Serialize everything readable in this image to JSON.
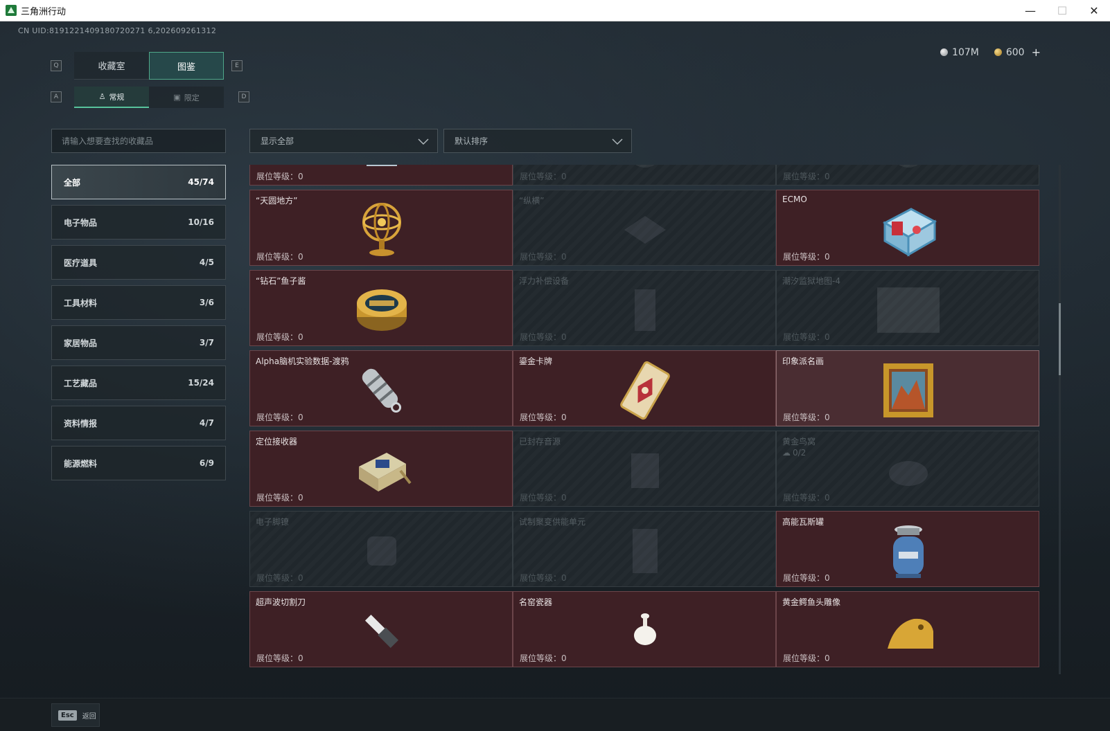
{
  "window": {
    "title": "三角洲行动",
    "minimize": "—",
    "maximize": "☐",
    "close": "✕"
  },
  "uid": "CN UID:8191221409180720271 6,202609261312",
  "currency": {
    "silver": "107M",
    "gold": "600",
    "plus": "+"
  },
  "keys": {
    "prev_tab": "Q",
    "next_tab": "E",
    "prev_sub": "A",
    "next_sub": "D"
  },
  "main_tabs": [
    {
      "label": "收藏室"
    },
    {
      "label": "图鉴"
    }
  ],
  "sub_tabs": [
    {
      "label": "常规"
    },
    {
      "label": "限定"
    }
  ],
  "search": {
    "placeholder": "请输入想要查找的收藏品"
  },
  "categories": [
    {
      "name": "全部",
      "count": "45/74"
    },
    {
      "name": "电子物品",
      "count": "10/16"
    },
    {
      "name": "医疗道具",
      "count": "4/5"
    },
    {
      "name": "工具材料",
      "count": "3/6"
    },
    {
      "name": "家居物品",
      "count": "3/7"
    },
    {
      "name": "工艺藏品",
      "count": "15/24"
    },
    {
      "name": "资料情报",
      "count": "4/7"
    },
    {
      "name": "能源燃料",
      "count": "6/9"
    }
  ],
  "filters": {
    "display": "显示全部",
    "sort": "默认排序"
  },
  "cards": [
    {
      "name": "",
      "level": "展位等级：0",
      "state": "owned",
      "icon": "robot-arm-icon"
    },
    {
      "name": "",
      "level": "展位等级：0",
      "state": "locked",
      "icon": "unknown-icon"
    },
    {
      "name": "",
      "level": "展位等级：0",
      "state": "locked",
      "icon": "unknown-icon"
    },
    {
      "name": "“天圆地方”",
      "level": "展位等级：0",
      "state": "owned",
      "icon": "armillary-sphere-icon"
    },
    {
      "name": "“纵横”",
      "level": "展位等级：0",
      "state": "locked",
      "icon": "chessboard-icon"
    },
    {
      "name": "ECMO",
      "level": "展位等级：0",
      "state": "owned",
      "icon": "ecmo-machine-icon"
    },
    {
      "name": "“钻石”鱼子酱",
      "level": "展位等级：0",
      "state": "owned",
      "icon": "caviar-tin-icon"
    },
    {
      "name": "浮力补偿设备",
      "level": "展位等级：0",
      "state": "locked",
      "icon": "buoyancy-device-icon"
    },
    {
      "name": "潮汐监狱地图-4",
      "level": "展位等级：0",
      "state": "locked",
      "icon": "map-icon"
    },
    {
      "name": "Alpha脑机实验数据-渡鸦",
      "level": "展位等级：0",
      "state": "owned",
      "icon": "data-capsule-icon"
    },
    {
      "name": "鎏金卡牌",
      "level": "展位等级：0",
      "state": "owned",
      "icon": "gilded-card-icon"
    },
    {
      "name": "印象派名画",
      "level": "展位等级：0",
      "state": "owned-light",
      "icon": "painting-icon"
    },
    {
      "name": "定位接收器",
      "level": "展位等级：0",
      "state": "owned",
      "icon": "receiver-icon"
    },
    {
      "name": "已封存音源",
      "level": "展位等级：0",
      "state": "locked",
      "icon": "audio-source-icon"
    },
    {
      "name": "黄金鸟窝",
      "sub": "0/2",
      "level": "展位等级：0",
      "state": "locked",
      "icon": "golden-nest-icon"
    },
    {
      "name": "电子脚镣",
      "level": "展位等级：0",
      "state": "locked",
      "icon": "ankle-monitor-icon"
    },
    {
      "name": "试制聚变供能单元",
      "level": "展位等级：0",
      "state": "locked",
      "icon": "fusion-unit-icon"
    },
    {
      "name": "高能瓦斯罐",
      "level": "展位等级：0",
      "state": "owned",
      "icon": "gas-tank-icon"
    },
    {
      "name": "超声波切割刀",
      "level": "展位等级：0",
      "state": "owned",
      "icon": "ultrasonic-knife-icon"
    },
    {
      "name": "名窑瓷器",
      "level": "展位等级：0",
      "state": "owned",
      "icon": "porcelain-icon"
    },
    {
      "name": "黄金鳄鱼头雕像",
      "level": "展位等级：0",
      "state": "owned",
      "icon": "crocodile-statue-icon"
    }
  ],
  "footer": {
    "esc_key": "Esc",
    "back_label": "返回"
  }
}
